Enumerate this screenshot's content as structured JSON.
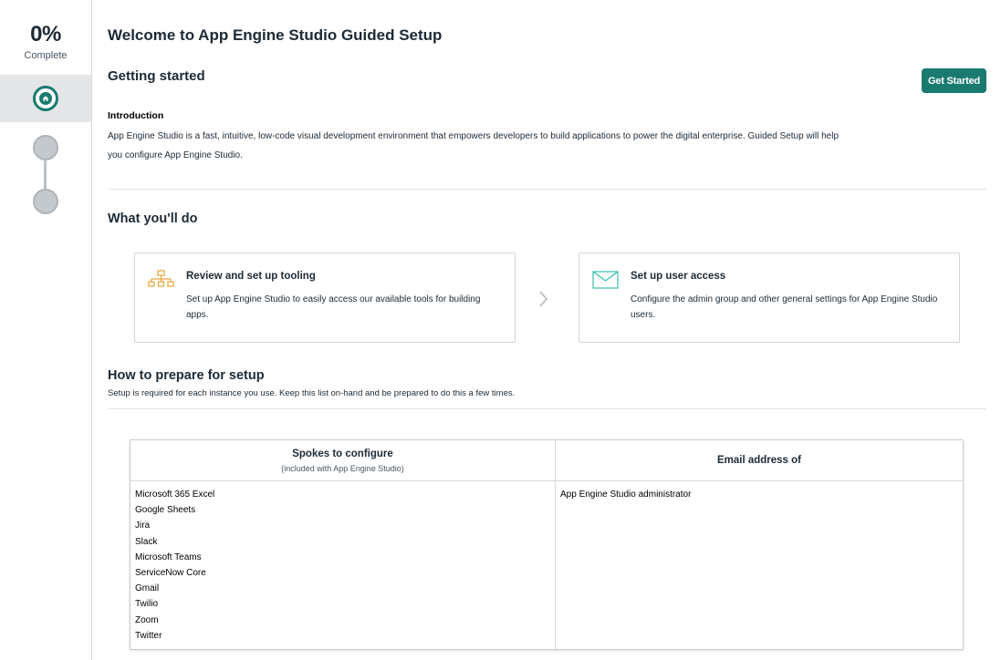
{
  "progress": {
    "percent": "0%",
    "label": "Complete",
    "steps": [
      "home",
      "step-2",
      "step-3"
    ],
    "active_step": "home"
  },
  "header": {
    "title": "Welcome to App Engine Studio Guided Setup"
  },
  "getting_started": {
    "title": "Getting started",
    "button_label": "Get Started",
    "intro_heading": "Introduction",
    "intro_line1": "App Engine Studio is a fast, intuitive, low-code visual development environment that empowers developers to build applications to power the digital enterprise. Guided Setup will help",
    "intro_line2": "you configure App Engine Studio."
  },
  "what_youll_do": {
    "title": "What you'll do",
    "cards": [
      {
        "icon": "hierarchy-icon",
        "title": "Review and set up tooling",
        "description": "Set up App Engine Studio to easily access our available tools for building apps."
      },
      {
        "icon": "envelope-icon",
        "title": "Set up user access",
        "description": "Configure the admin group and other general settings for App Engine Studio users."
      }
    ]
  },
  "prepare": {
    "title": "How to prepare for setup",
    "subtitle": "Setup is required for each instance you use. Keep this list on-hand and be prepared to do this a few times."
  },
  "table": {
    "col1_header": "Spokes to configure",
    "col1_subheader": "(included with App Engine Studio)",
    "col2_header": "Email address of",
    "spokes": [
      "Microsoft 365 Excel",
      "Google Sheets",
      "Jira",
      "Slack",
      "Microsoft Teams",
      "ServiceNow Core",
      "Gmail",
      "Twilio",
      "Zoom",
      "Twitter"
    ],
    "emails": [
      "App Engine Studio administrator"
    ]
  },
  "colors": {
    "accent": "#1a7a70",
    "icon_orange": "#e8a33c",
    "icon_teal": "#3bbfae"
  }
}
